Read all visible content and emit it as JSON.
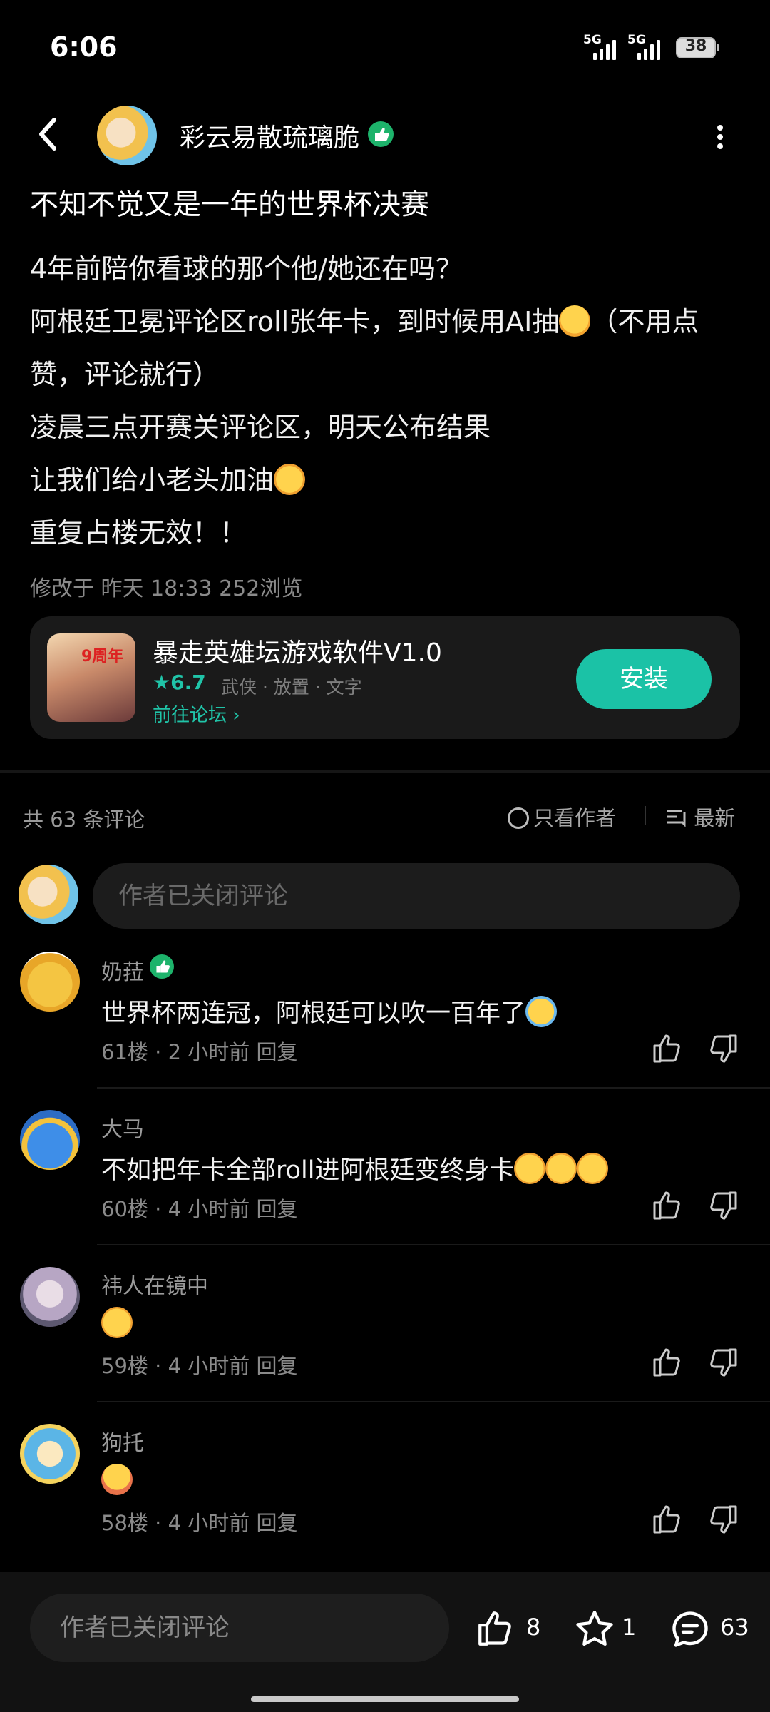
{
  "status_bar": {
    "time": "6:06",
    "signal_1": "5G",
    "signal_2": "5G",
    "battery": "38"
  },
  "header": {
    "author_name": "彩云易散琉璃脆"
  },
  "post": {
    "title": "不知不觉又是一年的世界杯决赛",
    "lines": [
      "4年前陪你看球的那个他/她还在吗？",
      "阿根廷卫冕评论区roll张年卡，到时候用AI抽",
      "（不用点",
      "赞，评论就行）",
      "凌晨三点开赛关评论区，明天公布结果",
      "让我们给小老头加油",
      "重复占楼无效！！"
    ],
    "meta": "修改于 昨天 18:33  252浏览"
  },
  "app_card": {
    "name": "暴走英雄坛游戏软件V1.0",
    "rating": "6.7",
    "tags": "武侠 · 放置 · 文字",
    "forum_link": "前往论坛",
    "install_label": "安装",
    "icon_text": "9周年"
  },
  "comments_header": {
    "count": "共 63 条评论",
    "only_author": "只看作者",
    "sort": "最新"
  },
  "comment_input": {
    "placeholder": "作者已关闭评论"
  },
  "comments": [
    {
      "name": "奶菈",
      "text": "世界杯两连冠，阿根廷可以吹一百年了",
      "floor": "61楼",
      "time": "2 小时前",
      "reply": "回复"
    },
    {
      "name": "大马",
      "text": "不如把年卡全部roll进阿根廷变终身卡",
      "floor": "60楼",
      "time": "4 小时前",
      "reply": "回复"
    },
    {
      "name": "祎人在镜中",
      "text": "",
      "floor": "59楼",
      "time": "4 小时前",
      "reply": "回复"
    },
    {
      "name": "狗托",
      "text": "",
      "floor": "58楼",
      "time": "4 小时前",
      "reply": "回复"
    }
  ],
  "bottom_bar": {
    "placeholder": "作者已关闭评论",
    "likes": "8",
    "stars": "1",
    "comments": "63"
  }
}
